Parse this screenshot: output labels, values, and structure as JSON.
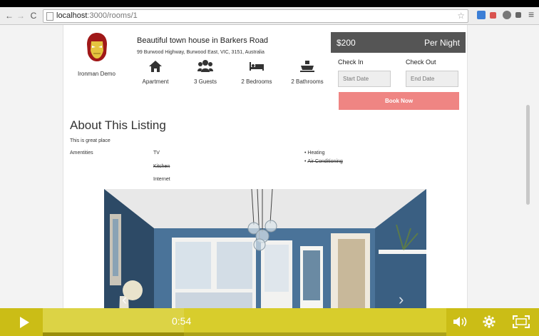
{
  "browser": {
    "url_host": "localhost",
    "url_rest": ":3000/rooms/1"
  },
  "listing": {
    "host_name": "Ironman Demo",
    "title": "Beautiful town house in Barkers Road",
    "address": "99 Burwood Highway, Burwood East, VIC, 3151, Australia",
    "features": [
      {
        "icon": "house-icon",
        "label": "Apartment"
      },
      {
        "icon": "guests-icon",
        "label": "3 Guests"
      },
      {
        "icon": "bed-icon",
        "label": "2 Bedrooms"
      },
      {
        "icon": "bath-icon",
        "label": "2 Bathrooms"
      }
    ]
  },
  "booking": {
    "price": "$200",
    "period": "Per Night",
    "check_in_label": "Check In",
    "check_out_label": "Check Out",
    "start_placeholder": "Start Date",
    "end_placeholder": "End Date",
    "book_label": "Book Now",
    "button_color": "#ef8583"
  },
  "about": {
    "title": "About This Listing",
    "description": "This is great place",
    "amenities_label": "Amentities",
    "amenities": [
      {
        "label": "TV",
        "available": true
      },
      {
        "label": "Kitchen",
        "available": false
      },
      {
        "label": "Internet",
        "available": true
      },
      {
        "label": "Heating",
        "available": true
      },
      {
        "label": "Air Conditioning",
        "available": false
      }
    ]
  },
  "player": {
    "time": "0:54",
    "progress": 0.35,
    "accent": "#d8cd2c",
    "icons": [
      "play-icon",
      "volume-icon",
      "settings-icon",
      "fullscreen-icon"
    ]
  }
}
